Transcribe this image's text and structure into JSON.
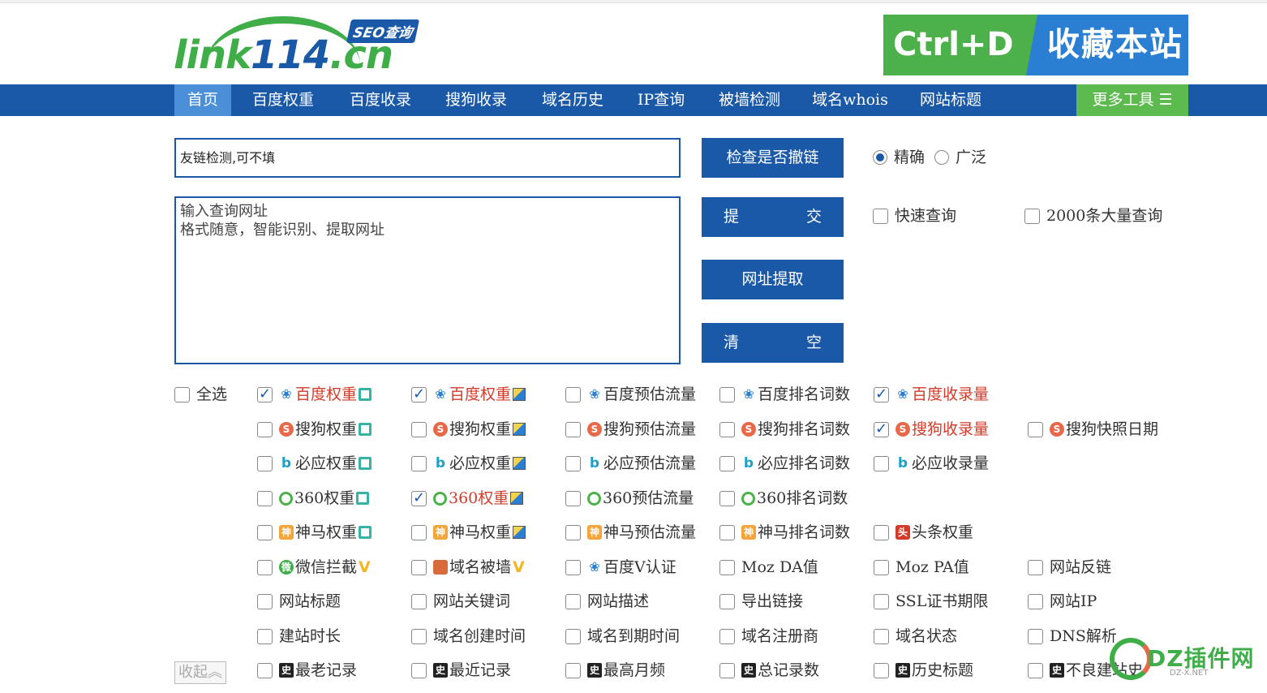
{
  "brand": {
    "logo_part1": "link",
    "logo_part2": "114",
    "logo_part3": ".cn",
    "logo_badge": "SEO查询",
    "bookmark_left": "Ctrl+D",
    "bookmark_right": "收藏本站"
  },
  "nav": {
    "items": [
      {
        "label": "首页"
      },
      {
        "label": "百度权重"
      },
      {
        "label": "百度收录"
      },
      {
        "label": "搜狗收录"
      },
      {
        "label": "域名历史"
      },
      {
        "label": "IP查询"
      },
      {
        "label": "被墙检测"
      },
      {
        "label": "域名whois"
      },
      {
        "label": "网站标题"
      }
    ],
    "more_label": "更多工具 ☰"
  },
  "form": {
    "friendlink_value": "友链检测,可不填",
    "url_input_value": "输入查询网址\n格式随意，智能识别、提取网址",
    "btn_check": "检查是否撤链",
    "btn_submit_a": "提",
    "btn_submit_b": "交",
    "btn_extract": "网址提取",
    "btn_clear_a": "清",
    "btn_clear_b": "空",
    "radio_exact": "精确",
    "radio_broad": "广泛",
    "quick_query": "快速查询",
    "bulk_query": "2000条大量查询"
  },
  "options": {
    "select_all": "全选",
    "rows": [
      [
        "百度权重",
        "百度权重",
        "百度预估流量",
        "百度排名词数",
        "百度收录量",
        ""
      ],
      [
        "搜狗权重",
        "搜狗权重",
        "搜狗预估流量",
        "搜狗排名词数",
        "搜狗收录量",
        "搜狗快照日期"
      ],
      [
        "必应权重",
        "必应权重",
        "必应预估流量",
        "必应排名词数",
        "必应收录量",
        ""
      ],
      [
        "360权重",
        "360权重",
        "360预估流量",
        "360排名词数",
        "",
        ""
      ],
      [
        "神马权重",
        "神马权重",
        "神马预估流量",
        "神马排名词数",
        "头条权重",
        ""
      ],
      [
        "微信拦截",
        "域名被墙",
        "百度V认证",
        "Moz DA值",
        "Moz PA值",
        "网站反链"
      ],
      [
        "网站标题",
        "网站关键词",
        "网站描述",
        "导出链接",
        "SSL证书期限",
        "网站IP"
      ],
      [
        "建站时长",
        "域名创建时间",
        "域名到期时间",
        "域名注册商",
        "域名状态",
        "DNS解析"
      ],
      [
        "最老记录",
        "最近记录",
        "最高月频",
        "总记录数",
        "历史标题",
        "不良建站史"
      ]
    ],
    "collapse_label": "收起︽"
  },
  "icon_glyphs": {
    "sogou": "S",
    "bing": "b",
    "shenma": "神",
    "toutiao": "头",
    "wechat": "微",
    "hist": "史",
    "v": "V"
  },
  "watermark": {
    "text": "DZ插件网",
    "sub": "DZ-X.NET"
  },
  "colors": {
    "nav_blue": "#1a58a8",
    "nav_active": "#4a8fd8",
    "more_green": "#5dba4e",
    "label_red": "#d23b2a"
  }
}
